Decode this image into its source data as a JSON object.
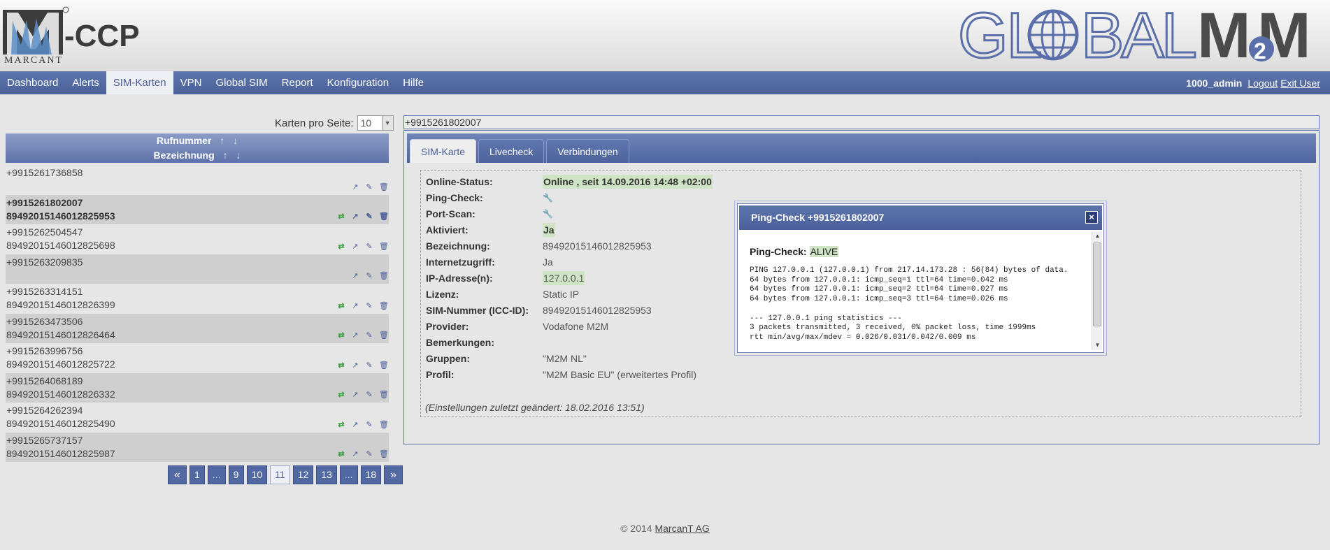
{
  "header": {
    "logo_left_text": "M-CCP",
    "logo_left_sub": "MARCANT",
    "logo_right_text": "GLOBALM2M"
  },
  "nav": {
    "items": [
      "Dashboard",
      "Alerts",
      "SIM-Karten",
      "VPN",
      "Global SIM",
      "Report",
      "Konfiguration",
      "Hilfe"
    ],
    "active": "SIM-Karten",
    "user": "1000_admin",
    "logout": "Logout",
    "exit_user": "Exit User"
  },
  "list": {
    "per_page_label": "Karten pro Seite:",
    "per_page_value": "10",
    "col1": "Rufnummer",
    "col2": "Bezeichnung",
    "sort_up": "↑",
    "sort_down": "↓",
    "rows": [
      {
        "number": "+9915261736858",
        "name": ""
      },
      {
        "number": "+9915261802007",
        "name": "89492015146012825953"
      },
      {
        "number": "+9915262504547",
        "name": "89492015146012825698"
      },
      {
        "number": "+9915263209835",
        "name": ""
      },
      {
        "number": "+9915263314151",
        "name": "89492015146012826399"
      },
      {
        "number": "+9915263473506",
        "name": "89492015146012826464"
      },
      {
        "number": "+9915263996756",
        "name": "89492015146012825722"
      },
      {
        "number": "+9915264068189",
        "name": "89492015146012826332"
      },
      {
        "number": "+9915264262394",
        "name": "89492015146012825490"
      },
      {
        "number": "+9915265737157",
        "name": "89492015146012825987"
      }
    ],
    "pager": [
      "«",
      "1",
      "...",
      "9",
      "10",
      "11",
      "12",
      "13",
      "...",
      "18",
      "»"
    ],
    "current_page": "11"
  },
  "detail": {
    "title": "+9915261802007",
    "tabs": [
      "SIM-Karte",
      "Livecheck",
      "Verbindungen"
    ],
    "active_tab": "SIM-Karte",
    "fields": {
      "online_status_label": "Online-Status:",
      "online_status": "Online , seit 14.09.2016 14:48 +02:00",
      "ping_label": "Ping-Check:",
      "portscan_label": "Port-Scan:",
      "aktiviert_label": "Aktiviert:",
      "aktiviert": "Ja",
      "bezeichnung_label": "Bezeichnung:",
      "bezeichnung": "89492015146012825953",
      "internet_label": "Internetzugriff:",
      "internet": "Ja",
      "ip_label": "IP-Adresse(n):",
      "ip": "127.0.0.1",
      "lizenz_label": "Lizenz:",
      "lizenz": "Static IP",
      "iccid_label": "SIM-Nummer (ICC-ID):",
      "iccid": "89492015146012825953",
      "provider_label": "Provider:",
      "provider": "Vodafone M2M",
      "bemerkungen_label": "Bemerkungen:",
      "bemerkungen": "",
      "gruppen_label": "Gruppen:",
      "gruppen": "\"M2M NL\"",
      "profil_label": "Profil:",
      "profil": "\"M2M Basic EU\" (erweitertes Profil)"
    },
    "changed": "(Einstellungen zuletzt geändert: 18.02.2016 13:51)"
  },
  "modal": {
    "title": "Ping-Check +9915261802007",
    "close": "×",
    "ping_label": "Ping-Check:",
    "ping_status": "ALIVE",
    "output": "PING 127.0.0.1 (127.0.0.1) from 217.14.173.28 : 56(84) bytes of data.\n64 bytes from 127.0.0.1: icmp_seq=1 ttl=64 time=0.042 ms\n64 bytes from 127.0.0.1: icmp_seq=2 ttl=64 time=0.027 ms\n64 bytes from 127.0.0.1: icmp_seq=3 ttl=64 time=0.026 ms\n\n--- 127.0.0.1 ping statistics ---\n3 packets transmitted, 3 received, 0% packet loss, time 1999ms\nrtt min/avg/max/mdev = 0.026/0.031/0.042/0.009 ms"
  },
  "footer": {
    "copyright": "© 2014",
    "company": "MarcanT AG"
  },
  "colors": {
    "nav": "#4f659f",
    "highlight": "#cfe4c4",
    "sync_icon": "#3aa040"
  }
}
